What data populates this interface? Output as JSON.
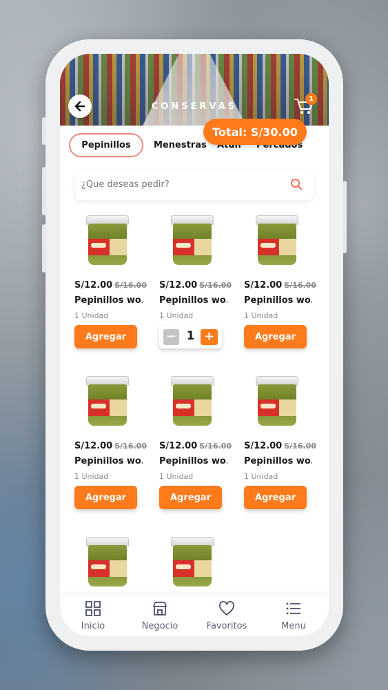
{
  "header": {
    "title": "CONSERVAS",
    "cart_count": "1",
    "total_label": "Total: S/30.00"
  },
  "tabs": [
    {
      "label": "Pepinillos",
      "active": true
    },
    {
      "label": "Menestras",
      "active": false
    },
    {
      "label": "Atún",
      "active": false
    },
    {
      "label": "Percados",
      "active": false
    }
  ],
  "search": {
    "placeholder": "¿Que deseas pedir?"
  },
  "products": [
    {
      "price": "S/12.00",
      "old_price": "S/16.00",
      "name": "Pepinillos wo...",
      "unit": "1 Unidad",
      "button": "Agregar"
    },
    {
      "price": "S/12.00",
      "old_price": "S/16.00",
      "name": "Pepinillos wo...",
      "unit": "1 Unidad",
      "quantity": "1",
      "minus": "−",
      "plus": "+"
    },
    {
      "price": "S/12.00",
      "old_price": "S/16.00",
      "name": "Pepinillos wo...",
      "unit": "1 Unidad",
      "button": "Agregar"
    },
    {
      "price": "S/12.00",
      "old_price": "S/16.00",
      "name": "Pepinillos wo...",
      "unit": "1 Unidad",
      "button": "Agregar"
    },
    {
      "price": "S/12.00",
      "old_price": "S/16.00",
      "name": "Pepinillos wo...",
      "unit": "1 Unidad",
      "button": "Agregar"
    },
    {
      "price": "S/12.00",
      "old_price": "S/16.00",
      "name": "Pepinillos wo...",
      "unit": "1 Unidad",
      "button": "Agregar"
    }
  ],
  "bottom_nav": [
    {
      "label": "Inicio",
      "icon": "grid-icon"
    },
    {
      "label": "Negocio",
      "icon": "store-icon"
    },
    {
      "label": "Favoritos",
      "icon": "heart-icon"
    },
    {
      "label": "Menu",
      "icon": "list-icon"
    }
  ],
  "colors": {
    "accent": "#ff7a1a",
    "tab_border": "#f08a7c",
    "text": "#1b1b1b",
    "muted": "#8a8a8a"
  }
}
